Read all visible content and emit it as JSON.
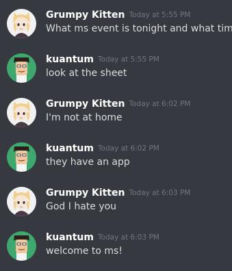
{
  "messages": [
    {
      "user": "Grumpy Kitten",
      "avatar": "grumpy",
      "time": "Today at 5:55 PM",
      "text": "What ms event is tonight and what time"
    },
    {
      "user": "kuantum",
      "avatar": "kuantum",
      "time": "Today at 5:55 PM",
      "text": "look at the sheet"
    },
    {
      "user": "Grumpy Kitten",
      "avatar": "grumpy",
      "time": "Today at 6:02 PM",
      "text": "I'm not at home"
    },
    {
      "user": "kuantum",
      "avatar": "kuantum",
      "time": "Today at 6:02 PM",
      "text": "they have an app"
    },
    {
      "user": "Grumpy Kitten",
      "avatar": "grumpy",
      "time": "Today at 6:03 PM",
      "text": "God I hate you"
    },
    {
      "user": "kuantum",
      "avatar": "kuantum",
      "time": "Today at 6:03 PM",
      "text": "welcome to ms!"
    }
  ],
  "colors": {
    "background": "#36393f",
    "username": "#ffffff",
    "timestamp": "#72767d",
    "message_text": "#dcddde"
  }
}
